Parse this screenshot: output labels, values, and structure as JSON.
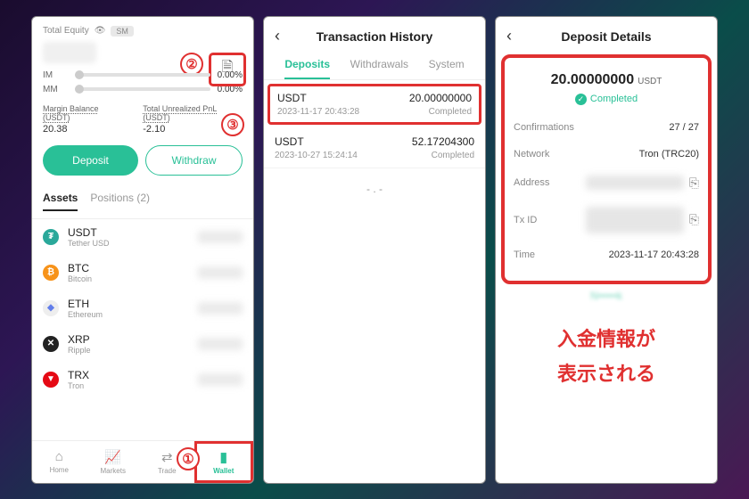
{
  "screen1": {
    "total_equity_label": "Total Equity",
    "sm_badge": "SM",
    "im_label": "IM",
    "mm_label": "MM",
    "im_pct": "0.00%",
    "mm_pct": "0.00%",
    "margin_balance_label": "Margin Balance (USDT)",
    "margin_balance_val": "20.38",
    "unrealized_label": "Total Unrealized PnL (USDT)",
    "unrealized_val": "-2.10",
    "deposit_btn": "Deposit",
    "withdraw_btn": "Withdraw",
    "assets_tab": "Assets",
    "positions_tab": "Positions (2)",
    "assets": [
      {
        "sym": "USDT",
        "name": "Tether USD",
        "bg": "#2aa89a",
        "fg": "#fff",
        "glyph": "₮"
      },
      {
        "sym": "BTC",
        "name": "Bitcoin",
        "bg": "#f7931a",
        "fg": "#fff",
        "glyph": "₿"
      },
      {
        "sym": "ETH",
        "name": "Ethereum",
        "bg": "#eee",
        "fg": "#627eea",
        "glyph": "◆"
      },
      {
        "sym": "XRP",
        "name": "Ripple",
        "bg": "#222",
        "fg": "#fff",
        "glyph": "✕"
      },
      {
        "sym": "TRX",
        "name": "Tron",
        "bg": "#e50914",
        "fg": "#fff",
        "glyph": "▼"
      }
    ],
    "nav": {
      "home": "Home",
      "markets": "Markets",
      "trade": "Trade",
      "wallet": "Wallet"
    }
  },
  "markers": {
    "m1": "①",
    "m2": "②",
    "m3": "③"
  },
  "screen2": {
    "title": "Transaction History",
    "tabs": {
      "deposits": "Deposits",
      "withdrawals": "Withdrawals",
      "system": "System"
    },
    "rows": [
      {
        "sym": "USDT",
        "amt": "20.00000000",
        "ts": "2023-11-17 20:43:28",
        "status": "Completed"
      },
      {
        "sym": "USDT",
        "amt": "52.17204300",
        "ts": "2023-10-27 15:24:14",
        "status": "Completed"
      }
    ],
    "end": "- . -"
  },
  "screen3": {
    "title": "Deposit Details",
    "amount": "20.00000000",
    "unit": "USDT",
    "status": "Completed",
    "confirmations_label": "Confirmations",
    "confirmations_val": "27 / 27",
    "network_label": "Network",
    "network_val": "Tron (TRC20)",
    "address_label": "Address",
    "txid_label": "Tx ID",
    "time_label": "Time",
    "time_val": "2023-11-17 20:43:28",
    "annotation_l1": "入金情報が",
    "annotation_l2": "表示される"
  }
}
